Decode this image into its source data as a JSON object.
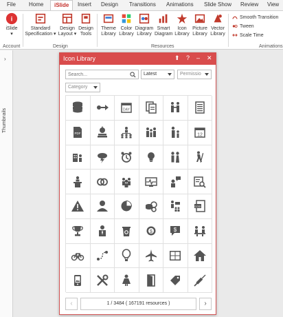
{
  "ribbon_tabs": [
    {
      "label": "File"
    },
    {
      "label": "Home"
    },
    {
      "label": "iSlide"
    },
    {
      "label": "Insert"
    },
    {
      "label": "Design"
    },
    {
      "label": "Transitions"
    },
    {
      "label": "Animations"
    },
    {
      "label": "Slide Show"
    },
    {
      "label": "Review"
    },
    {
      "label": "View"
    }
  ],
  "active_tab": "iSlide",
  "groups": {
    "account": {
      "label": "Account",
      "button": "iSlide"
    },
    "design": {
      "label": "Design",
      "buttons": [
        {
          "line1": "Standard",
          "line2": "Specification ▾"
        },
        {
          "line1": "Design",
          "line2": "Layout ▾"
        },
        {
          "line1": "Design",
          "line2": "Tools"
        }
      ]
    },
    "resources": {
      "label": "Resources",
      "buttons": [
        {
          "line1": "Theme",
          "line2": "Library"
        },
        {
          "line1": "Color",
          "line2": "Library"
        },
        {
          "line1": "Diagram",
          "line2": "Library"
        },
        {
          "line1": "Smart",
          "line2": "Diagram"
        },
        {
          "line1": "Icon",
          "line2": "Library"
        },
        {
          "line1": "Picture",
          "line2": "Library"
        },
        {
          "line1": "Vector",
          "line2": "Library"
        }
      ]
    },
    "animations": {
      "label": "Animations",
      "items": [
        {
          "label": "Smooth Transition"
        },
        {
          "label": "Tween"
        },
        {
          "label": "Scale Time"
        }
      ]
    }
  },
  "thumbnails": {
    "label": "Thumbnails",
    "toggle": "›"
  },
  "panel": {
    "title": "Icon Library",
    "controls": {
      "pin": "⬆",
      "help": "?",
      "minimize": "–",
      "close": "✕"
    },
    "search": {
      "placeholder": "Search...",
      "value": ""
    },
    "sort": {
      "value": "Latest"
    },
    "permission": {
      "placeholder": "Permissio"
    },
    "category": {
      "placeholder": "Category"
    },
    "icons": [
      "database-icon",
      "key-arrow-icon",
      "calendar-day-icon",
      "documents-icon",
      "handshake-people-icon",
      "document-list-icon",
      "pdf-file-icon",
      "apple-books-icon",
      "org-chart-icon",
      "family-icon",
      "parent-child-icon",
      "calendar-12-icon",
      "building-person-icon",
      "storm-cloud-icon",
      "alarm-clock-icon",
      "lightbulb-icon",
      "couple-icon",
      "hiker-icon",
      "speaker-podium-icon",
      "rings-icon",
      "team-icon",
      "heart-monitor-icon",
      "support-chat-icon",
      "search-report-icon",
      "warning-icon",
      "user-icon",
      "pie-chart-icon",
      "coins-icon",
      "speaker-audience-icon",
      "code-document-icon",
      "trophy-icon",
      "businessman-icon",
      "recycle-bin-icon",
      "dollar-gear-icon",
      "dollar-chat-icon",
      "meeting-table-icon",
      "bicycle-icon",
      "route-icon",
      "hot-air-balloon-icon",
      "airplane-icon",
      "window-icon",
      "house-icon",
      "mobile-photo-icon",
      "tools-icon",
      "woman-icon",
      "exit-door-icon",
      "price-tag-icon",
      "syringe-icon"
    ],
    "pager": {
      "prev": "‹",
      "next": "›",
      "info": "1 / 3484 ( 167191 resources )"
    }
  }
}
